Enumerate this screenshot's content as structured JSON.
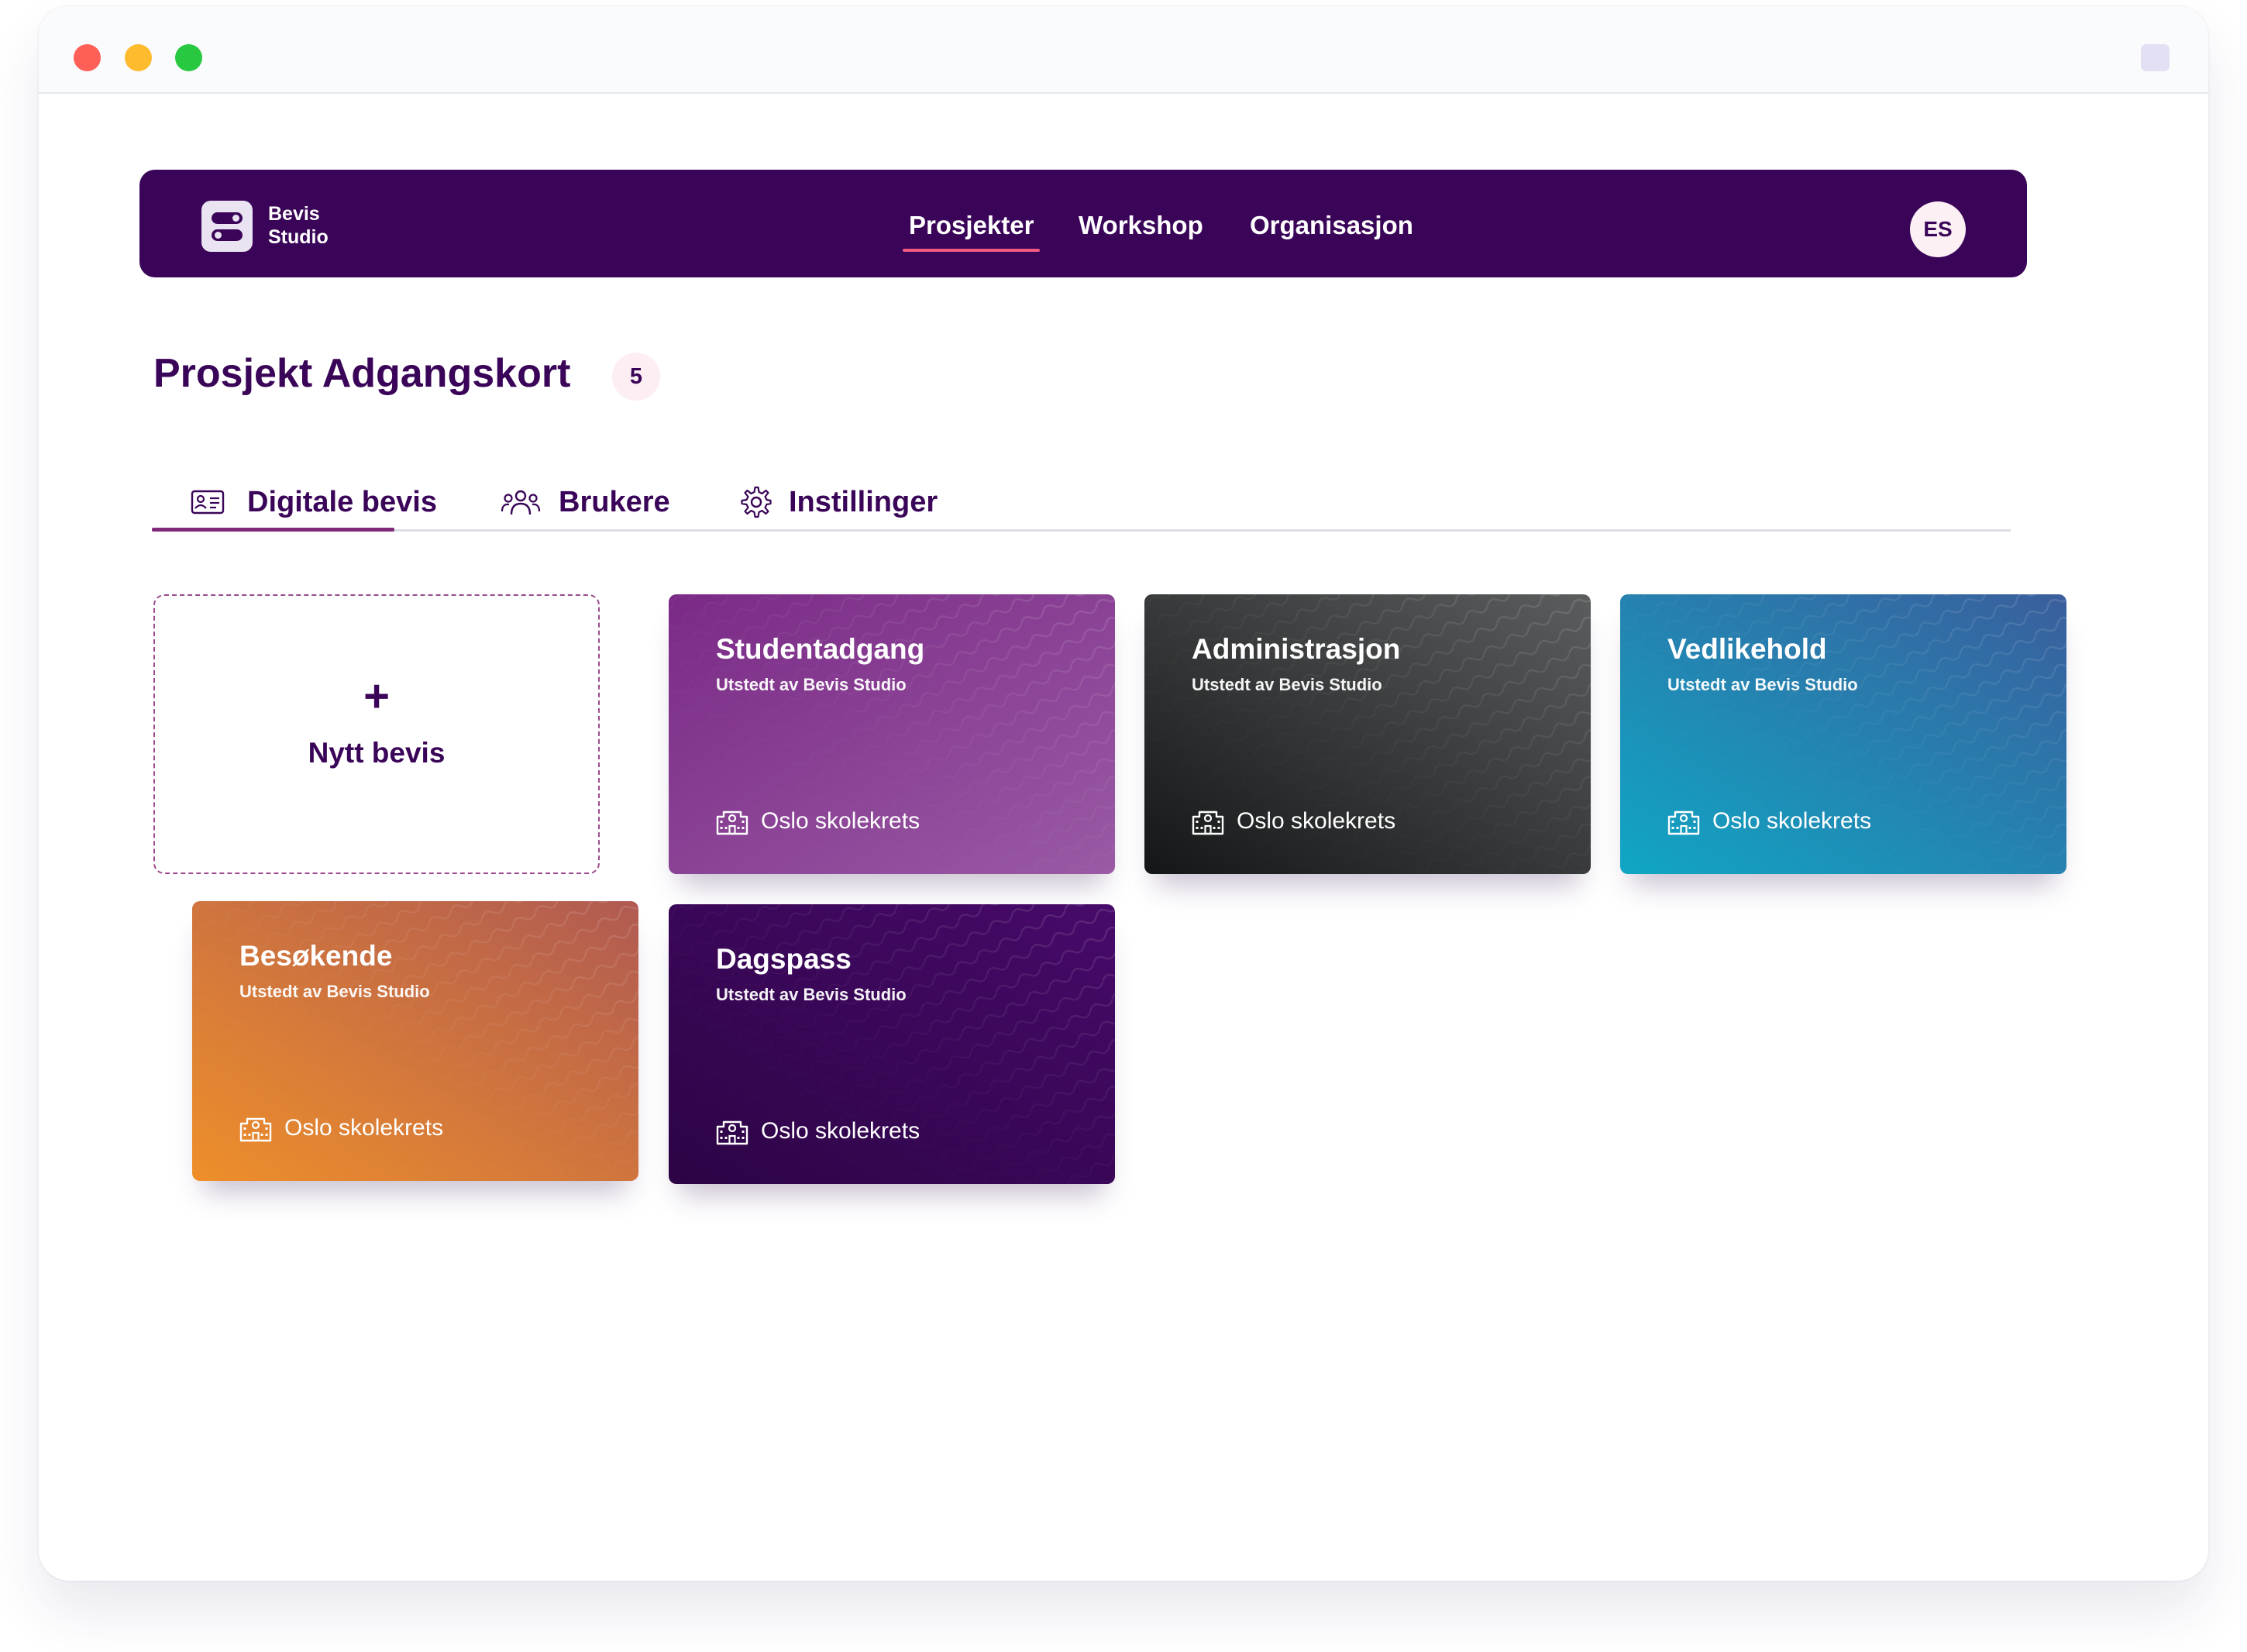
{
  "app": {
    "brand_line1": "Bevis",
    "brand_line2": "Studio"
  },
  "nav": {
    "items": [
      "Prosjekter",
      "Workshop",
      "Organisasjon"
    ],
    "active": "Prosjekter",
    "user_initials": "ES"
  },
  "page": {
    "title": "Prosjekt Adgangskort",
    "count": "5"
  },
  "tabs": [
    {
      "label": "Digitale bevis",
      "icon": "id-card-icon",
      "active": true
    },
    {
      "label": "Brukere",
      "icon": "users-icon",
      "active": false
    },
    {
      "label": "Instillinger",
      "icon": "gear-icon",
      "active": false
    }
  ],
  "new_card": {
    "plus": "+",
    "label": "Nytt bevis"
  },
  "cards": [
    {
      "title": "Studentadgang",
      "subtitle": "Utstedt av Bevis Studio",
      "location": "Oslo skolekrets",
      "color_from": "#7a2a86",
      "color_to": "#9a5aa4"
    },
    {
      "title": "Administrasjon",
      "subtitle": "Utstedt av Bevis Studio",
      "location": "Oslo skolekrets",
      "color_from": "#141617",
      "color_to": "#5b5d5e"
    },
    {
      "title": "Vedlikehold",
      "subtitle": "Utstedt av Bevis Studio",
      "location": "Oslo skolekrets",
      "color_from": "#10a6c4",
      "color_to": "#3a5e9c"
    },
    {
      "title": "Besøkende",
      "subtitle": "Utstedt av Bevis Studio",
      "location": "Oslo skolekrets",
      "color_from": "#ee8f2a",
      "color_to": "#b05a52"
    },
    {
      "title": "Dagspass",
      "subtitle": "Utstedt av Bevis Studio",
      "location": "Oslo skolekrets",
      "color_from": "#2c0445",
      "color_to": "#470a6a"
    }
  ],
  "colors": {
    "primary": "#3a0558",
    "accent_underline": "#ee5a82",
    "tab_indicator": "#80287a"
  }
}
